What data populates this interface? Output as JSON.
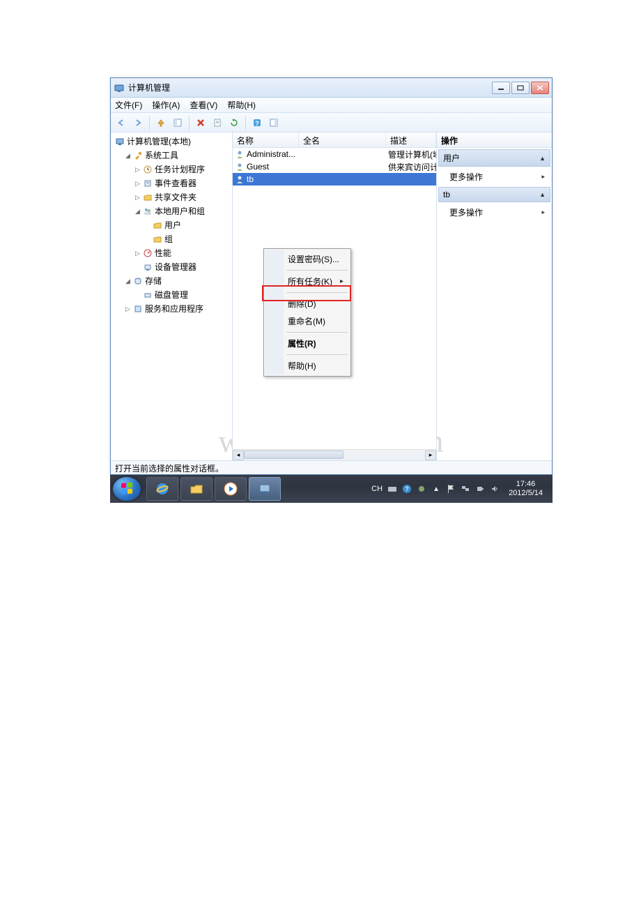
{
  "window": {
    "title": "计算机管理"
  },
  "menu": {
    "file": "文件(F)",
    "action": "操作(A)",
    "view": "查看(V)",
    "help": "帮助(H)"
  },
  "tree": {
    "root": "计算机管理(本地)",
    "sys_tools": "系统工具",
    "task_sched": "任务计划程序",
    "event_viewer": "事件查看器",
    "shared_folders": "共享文件夹",
    "local_users": "本地用户和组",
    "users": "用户",
    "groups": "组",
    "performance": "性能",
    "device_mgr": "设备管理器",
    "storage": "存储",
    "disk_mgmt": "磁盘管理",
    "services_apps": "服务和应用程序"
  },
  "columns": {
    "name": "名称",
    "fullname": "全名",
    "desc": "描述"
  },
  "users": [
    {
      "name": "Administrat...",
      "full": "",
      "desc": "管理计算机(域"
    },
    {
      "name": "Guest",
      "full": "",
      "desc": "供来宾访问计"
    },
    {
      "name": "tb",
      "full": "",
      "desc": ""
    }
  ],
  "ctx": {
    "set_pwd": "设置密码(S)...",
    "all_tasks": "所有任务(K)",
    "delete": "删除(D)",
    "rename": "重命名(M)",
    "properties": "属性(R)",
    "help": "帮助(H)"
  },
  "actions": {
    "header": "操作",
    "sec1": "用户",
    "sec2": "tb",
    "more": "更多操作"
  },
  "status": "打开当前选择的属性对话框。",
  "taskbar": {
    "ime": "CH",
    "time": "17:46",
    "date": "2012/5/14"
  },
  "watermark": "www.bdocx.com"
}
